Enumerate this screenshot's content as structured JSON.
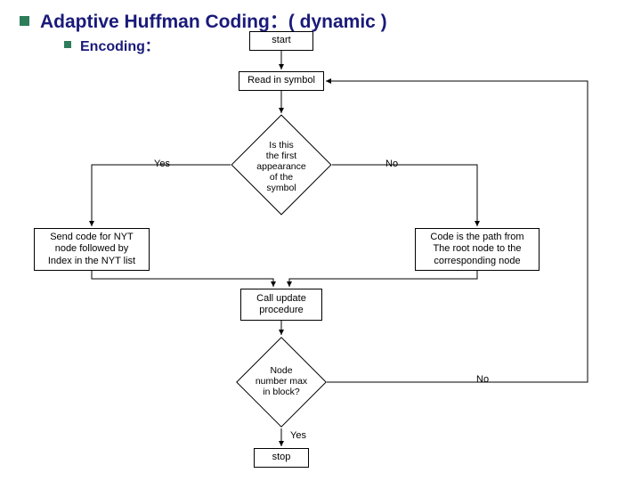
{
  "title": "Adaptive Huffman Coding：( dynamic )",
  "subtitle": "Encoding：",
  "nodes": {
    "start": "start",
    "read": "Read in symbol",
    "decision1": "Is this\nthe first\nappearance\nof the\nsymbol",
    "leftBox": "Send code for NYT\nnode followed by\nIndex in the NYT list",
    "rightBox": "Code is the path from\nThe root node to the\ncorresponding node",
    "update": "Call update\nprocedure",
    "decision2": "Node\nnumber max\nin block?",
    "stop": "stop"
  },
  "labels": {
    "yes1": "Yes",
    "no1": "No",
    "yes2": "Yes",
    "no2": "No"
  }
}
